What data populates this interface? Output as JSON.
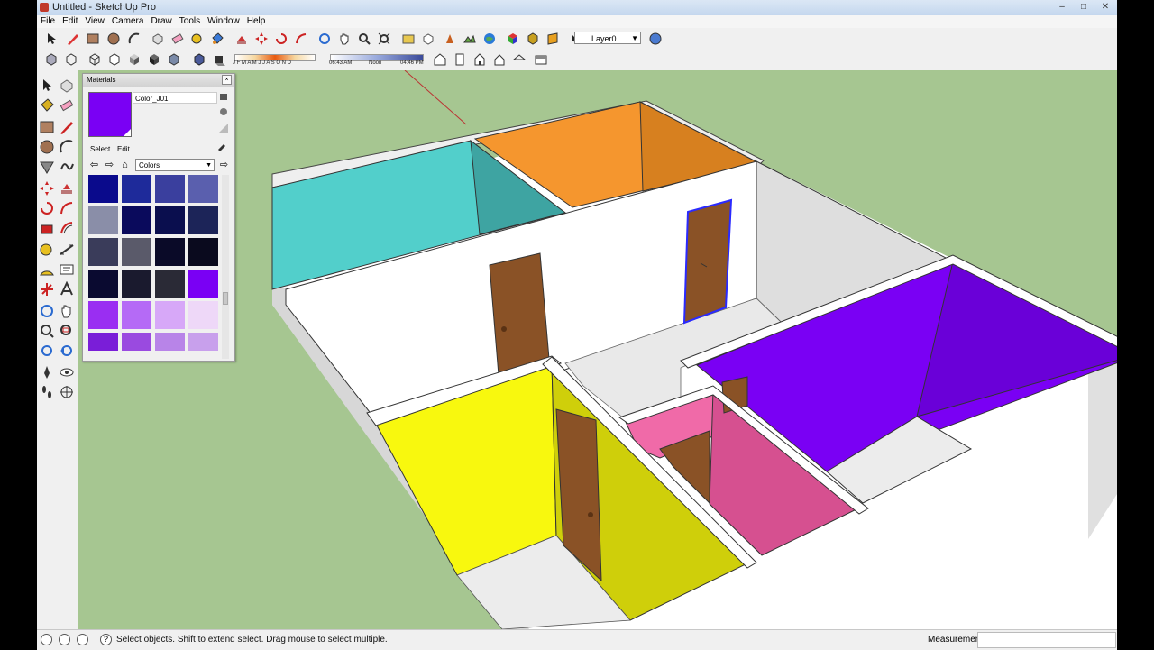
{
  "window": {
    "title": "Untitled - SketchUp Pro",
    "minimize": "–",
    "maximize": "□",
    "close": "✕"
  },
  "menu": [
    "File",
    "Edit",
    "View",
    "Camera",
    "Draw",
    "Tools",
    "Window",
    "Help"
  ],
  "toolbar": {
    "layer_value": "Layer0",
    "shadow_months": "J F M A M J J A S O N D",
    "time_start": "06:43 AM",
    "time_noon": "Noon",
    "time_end": "04:46 PM"
  },
  "materials_panel": {
    "title": "Materials",
    "close": "×",
    "material_name": "Color_J01",
    "tab_select": "Select",
    "tab_edit": "Edit",
    "collection": "Colors",
    "selected_color": "#7a00f4",
    "swatches": [
      "#0a0a8c",
      "#1e2a9a",
      "#3a3f9e",
      "#5a5fae",
      "#8a8ea8",
      "#0a0a5c",
      "#0a0e4e",
      "#1c2458",
      "#3a3c5a",
      "#5a5a6a",
      "#0a0a28",
      "#0a0a1e",
      "#0a0a30",
      "#1a1a2e",
      "#2a2a36",
      "#7a00f4",
      "#9a2ef2",
      "#b56af6",
      "#d7a8f8",
      "#eed8f8",
      "#7a1ed8",
      "#9a4ae0",
      "#b884e8",
      "#c8a0ec"
    ]
  },
  "status": {
    "message": "Select objects. Shift to extend select. Drag mouse to select multiple.",
    "measurements_label": "Measurements"
  },
  "scene": {
    "ground": "#a6c691",
    "walls": "#ffffff",
    "room_cyan": "#52cfcb",
    "room_orange": "#f5962e",
    "room_purple": "#7a00f4",
    "room_yellow": "#f8f80e",
    "room_pink": "#d65090",
    "door": "#8a5226"
  }
}
